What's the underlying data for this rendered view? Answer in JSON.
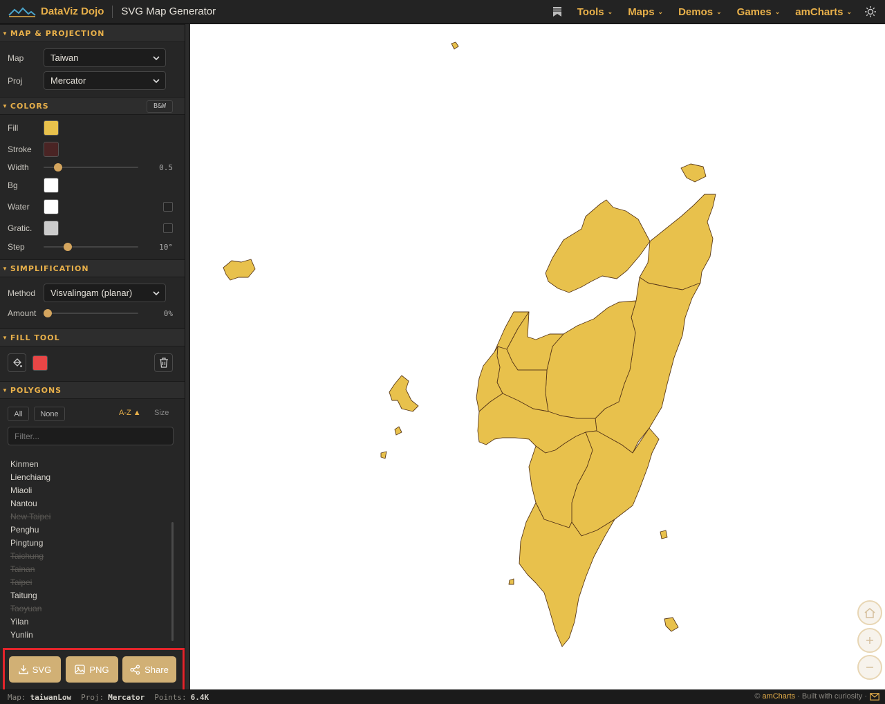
{
  "header": {
    "brand": "DataViz Dojo",
    "page_title": "SVG Map Generator",
    "nav": [
      "Tools",
      "Maps",
      "Demos",
      "Games",
      "amCharts"
    ]
  },
  "sections": {
    "map_projection": "MAP & PROJECTION",
    "colors": "COLORS",
    "simplification": "SIMPLIFICATION",
    "fill_tool": "FILL TOOL",
    "polygons": "POLYGONS"
  },
  "map_projection": {
    "map_label": "Map",
    "map_value": "Taiwan",
    "proj_label": "Proj",
    "proj_value": "Mercator"
  },
  "colors": {
    "bw_button": "B&W",
    "fill_label": "Fill",
    "fill_color": "#e8c14c",
    "stroke_label": "Stroke",
    "stroke_color": "#4a2424",
    "width_label": "Width",
    "width_value": "0.5",
    "width_level": 0.12,
    "bg_label": "Bg",
    "bg_color": "#ffffff",
    "water_label": "Water",
    "water_color": "#ffffff",
    "gratic_label": "Gratic.",
    "gratic_color": "#cccccc",
    "step_label": "Step",
    "step_value": "10°",
    "step_level": 0.23
  },
  "simplification": {
    "method_label": "Method",
    "method_value": "Visvalingam (planar)",
    "amount_label": "Amount",
    "amount_value": "0%",
    "amount_level": 0
  },
  "fill_tool": {
    "color": "#e84646"
  },
  "polygons": {
    "all_button": "All",
    "none_button": "None",
    "sort_az": "A-Z ▲",
    "sort_size": "Size",
    "filter_placeholder": "Filter...",
    "items": [
      {
        "name": "Kinmen",
        "enabled": true
      },
      {
        "name": "Lienchiang",
        "enabled": true
      },
      {
        "name": "Miaoli",
        "enabled": true
      },
      {
        "name": "Nantou",
        "enabled": true
      },
      {
        "name": "New Taipei",
        "enabled": false
      },
      {
        "name": "Penghu",
        "enabled": true
      },
      {
        "name": "Pingtung",
        "enabled": true
      },
      {
        "name": "Taichung",
        "enabled": false
      },
      {
        "name": "Tainan",
        "enabled": false
      },
      {
        "name": "Taipei",
        "enabled": false
      },
      {
        "name": "Taitung",
        "enabled": true
      },
      {
        "name": "Taoyuan",
        "enabled": false
      },
      {
        "name": "Yilan",
        "enabled": true
      },
      {
        "name": "Yunlin",
        "enabled": true
      }
    ]
  },
  "export": {
    "svg": "SVG",
    "png": "PNG",
    "share": "Share"
  },
  "status": {
    "map_label": "Map:",
    "map_value": "taiwanLow",
    "proj_label": "Proj:",
    "proj_value": "Mercator",
    "points_label": "Points:",
    "points_value": "6.4K",
    "copyright": "©",
    "brand_link": "amCharts",
    "tagline": "· Built with curiosity ·"
  },
  "map": {
    "fill": "#e8c14c",
    "stroke": "#5a3a1a",
    "background": "#ffffff"
  }
}
